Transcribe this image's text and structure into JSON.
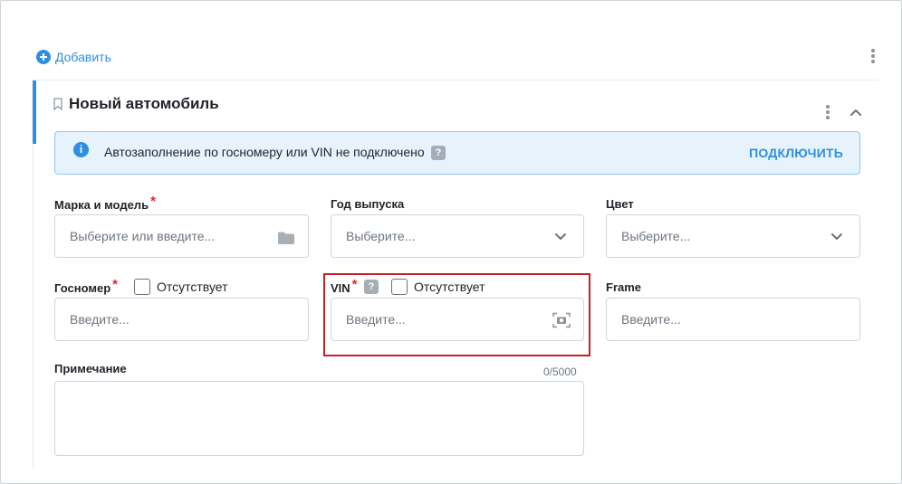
{
  "toolbar": {
    "add_label": "Добавить"
  },
  "card": {
    "title": "Новый автомобиль"
  },
  "banner": {
    "text": "Автозаполнение по госномеру или VIN не подключено",
    "help": "?",
    "info": "i",
    "action": "ПОДКЛЮЧИТЬ"
  },
  "fields": {
    "brand": {
      "label": "Марка и модель",
      "required": "*",
      "placeholder": "Выберите или введите..."
    },
    "year": {
      "label": "Год выпуска",
      "placeholder": "Выберите..."
    },
    "color": {
      "label": "Цвет",
      "placeholder": "Выберите..."
    },
    "plate": {
      "label": "Госномер",
      "required": "*",
      "absent_label": "Отсутствует",
      "placeholder": "Введите..."
    },
    "vin": {
      "label": "VIN",
      "required": "*",
      "help": "?",
      "absent_label": "Отсутствует",
      "placeholder": "Введите..."
    },
    "frame": {
      "label": "Frame",
      "placeholder": "Введите..."
    },
    "note": {
      "label": "Примечание",
      "counter": "0/5000"
    }
  },
  "icons": {
    "add": "plus-circle-icon",
    "more": "more-vertical-icon",
    "collapse": "chevron-up-icon",
    "bookmark": "bookmark-icon",
    "info": "info-icon",
    "help": "question-icon",
    "folder": "folder-icon",
    "dropdown": "chevron-down-icon",
    "scan": "camera-scan-icon"
  },
  "colors": {
    "accent": "#2f8ee0",
    "banner_bg": "#e6f3fd",
    "banner_border": "#8fc6ef",
    "required": "#e5252a",
    "highlight": "#c42026"
  }
}
